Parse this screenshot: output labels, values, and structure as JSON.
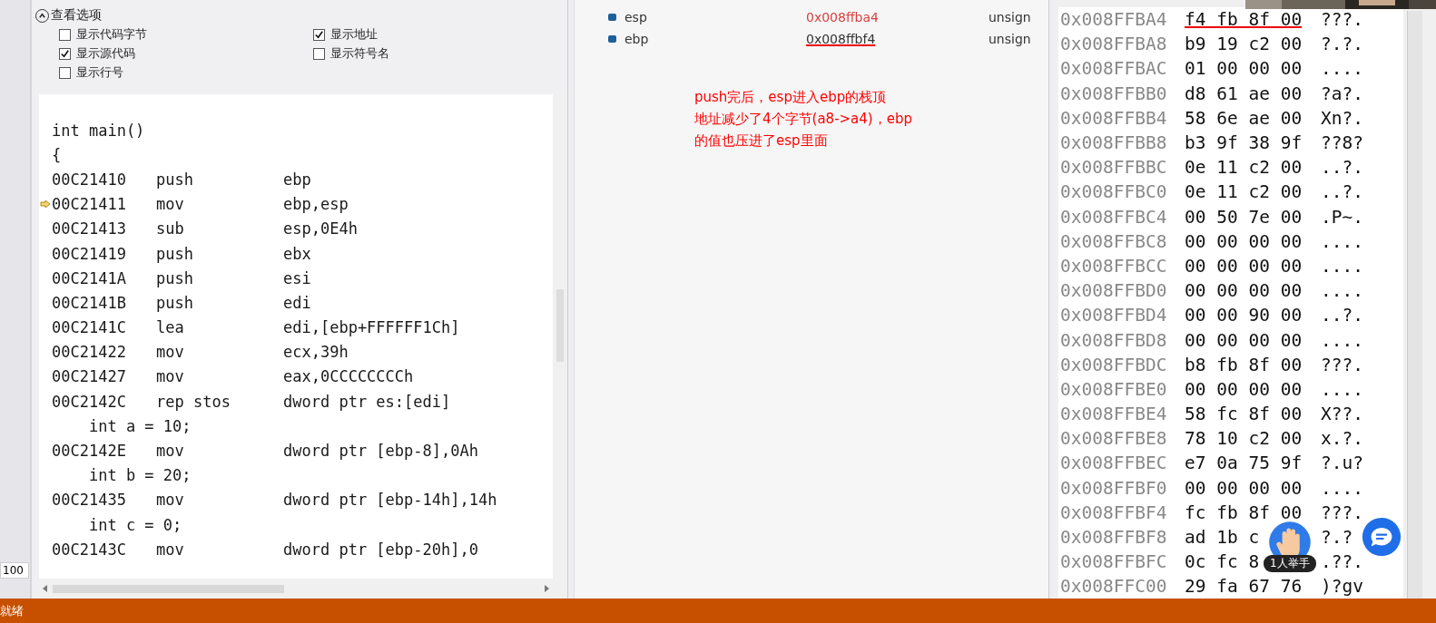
{
  "view_options": {
    "title": "查看选项",
    "expanded": true,
    "checkboxes": [
      {
        "label": "显示代码字节",
        "checked": false
      },
      {
        "label": "显示地址",
        "checked": true
      },
      {
        "label": "显示源代码",
        "checked": true
      },
      {
        "label": "显示符号名",
        "checked": false
      },
      {
        "label": "显示行号",
        "checked": false
      }
    ]
  },
  "code_lines": [
    {
      "kind": "source",
      "text": "int main()"
    },
    {
      "kind": "source",
      "text": "{"
    },
    {
      "kind": "asm",
      "address": "00C21410",
      "mnemonic": "push",
      "operands": "ebp",
      "current": false
    },
    {
      "kind": "asm",
      "address": "00C21411",
      "mnemonic": "mov",
      "operands": "ebp,esp",
      "current": true
    },
    {
      "kind": "asm",
      "address": "00C21413",
      "mnemonic": "sub",
      "operands": "esp,0E4h",
      "current": false
    },
    {
      "kind": "asm",
      "address": "00C21419",
      "mnemonic": "push",
      "operands": "ebx",
      "current": false
    },
    {
      "kind": "asm",
      "address": "00C2141A",
      "mnemonic": "push",
      "operands": "esi",
      "current": false
    },
    {
      "kind": "asm",
      "address": "00C2141B",
      "mnemonic": "push",
      "operands": "edi",
      "current": false
    },
    {
      "kind": "asm",
      "address": "00C2141C",
      "mnemonic": "lea",
      "operands": "edi,[ebp+FFFFFF1Ch]",
      "current": false
    },
    {
      "kind": "asm",
      "address": "00C21422",
      "mnemonic": "mov",
      "operands": "ecx,39h",
      "current": false
    },
    {
      "kind": "asm",
      "address": "00C21427",
      "mnemonic": "mov",
      "operands": "eax,0CCCCCCCCh",
      "current": false
    },
    {
      "kind": "asm",
      "address": "00C2142C",
      "mnemonic": "rep stos",
      "operands": "dword ptr es:[edi]",
      "current": false
    },
    {
      "kind": "source",
      "text": "    int a = 10;"
    },
    {
      "kind": "asm",
      "address": "00C2142E",
      "mnemonic": "mov",
      "operands": "dword ptr [ebp-8],0Ah",
      "current": false
    },
    {
      "kind": "source",
      "text": "    int b = 20;"
    },
    {
      "kind": "asm",
      "address": "00C21435",
      "mnemonic": "mov",
      "operands": "dword ptr [ebp-14h],14h",
      "current": false
    },
    {
      "kind": "source",
      "text": "    int c = 0;"
    },
    {
      "kind": "asm",
      "address": "00C2143C",
      "mnemonic": "mov",
      "operands": "dword ptr [ebp-20h],0",
      "current": false
    }
  ],
  "zoom": "100",
  "registers": [
    {
      "name": "esp",
      "value": "0x008ffba4",
      "type": "unsign",
      "changed": true,
      "underlined": false
    },
    {
      "name": "ebp",
      "value": "0x008ffbf4",
      "type": "unsign",
      "changed": false,
      "underlined": true
    }
  ],
  "annotation": {
    "lines": [
      "push完后，esp进入ebp的栈顶",
      "地址减少了4个字节(a8->a4)，ebp",
      "的值也压进了esp里面"
    ]
  },
  "memory_rows": [
    {
      "address": "0x008FFBA4",
      "bytes": "f4 fb 8f 00",
      "chars": "???.",
      "underlined": true
    },
    {
      "address": "0x008FFBA8",
      "bytes": "b9 19 c2 00",
      "chars": "?.?.",
      "underlined": false
    },
    {
      "address": "0x008FFBAC",
      "bytes": "01 00 00 00",
      "chars": "....",
      "underlined": false
    },
    {
      "address": "0x008FFBB0",
      "bytes": "d8 61 ae 00",
      "chars": "?a?.",
      "underlined": false
    },
    {
      "address": "0x008FFBB4",
      "bytes": "58 6e ae 00",
      "chars": "Xn?.",
      "underlined": false
    },
    {
      "address": "0x008FFBB8",
      "bytes": "b3 9f 38 9f",
      "chars": "??8?",
      "underlined": false
    },
    {
      "address": "0x008FFBBC",
      "bytes": "0e 11 c2 00",
      "chars": "..?.",
      "underlined": false
    },
    {
      "address": "0x008FFBC0",
      "bytes": "0e 11 c2 00",
      "chars": "..?.",
      "underlined": false
    },
    {
      "address": "0x008FFBC4",
      "bytes": "00 50 7e 00",
      "chars": ".P~.",
      "underlined": false
    },
    {
      "address": "0x008FFBC8",
      "bytes": "00 00 00 00",
      "chars": "....",
      "underlined": false
    },
    {
      "address": "0x008FFBCC",
      "bytes": "00 00 00 00",
      "chars": "....",
      "underlined": false
    },
    {
      "address": "0x008FFBD0",
      "bytes": "00 00 00 00",
      "chars": "....",
      "underlined": false
    },
    {
      "address": "0x008FFBD4",
      "bytes": "00 00 90 00",
      "chars": "..?.",
      "underlined": false
    },
    {
      "address": "0x008FFBD8",
      "bytes": "00 00 00 00",
      "chars": "....",
      "underlined": false
    },
    {
      "address": "0x008FFBDC",
      "bytes": "b8 fb 8f 00",
      "chars": "???.",
      "underlined": false
    },
    {
      "address": "0x008FFBE0",
      "bytes": "00 00 00 00",
      "chars": "....",
      "underlined": false
    },
    {
      "address": "0x008FFBE4",
      "bytes": "58 fc 8f 00",
      "chars": "X??.",
      "underlined": false
    },
    {
      "address": "0x008FFBE8",
      "bytes": "78 10 c2 00",
      "chars": "x.?.",
      "underlined": false
    },
    {
      "address": "0x008FFBEC",
      "bytes": "e7 0a 75 9f",
      "chars": "?.u?",
      "underlined": false
    },
    {
      "address": "0x008FFBF0",
      "bytes": "00 00 00 00",
      "chars": "....",
      "underlined": false
    },
    {
      "address": "0x008FFBF4",
      "bytes": "fc fb 8f 00",
      "chars": "???.",
      "underlined": false
    },
    {
      "address": "0x008FFBF8",
      "bytes": "ad 1b c",
      "chars": "?.?",
      "underlined": false
    },
    {
      "address": "0x008FFBFC",
      "bytes": "0c fc 8",
      "chars": ".??.",
      "underlined": false
    },
    {
      "address": "0x008FFC00",
      "bytes": "29 fa 67 76",
      "chars": ")?gv",
      "underlined": false
    }
  ],
  "raise_hand": {
    "label": "1人举手"
  },
  "status_bar": {
    "text": "就绪"
  }
}
